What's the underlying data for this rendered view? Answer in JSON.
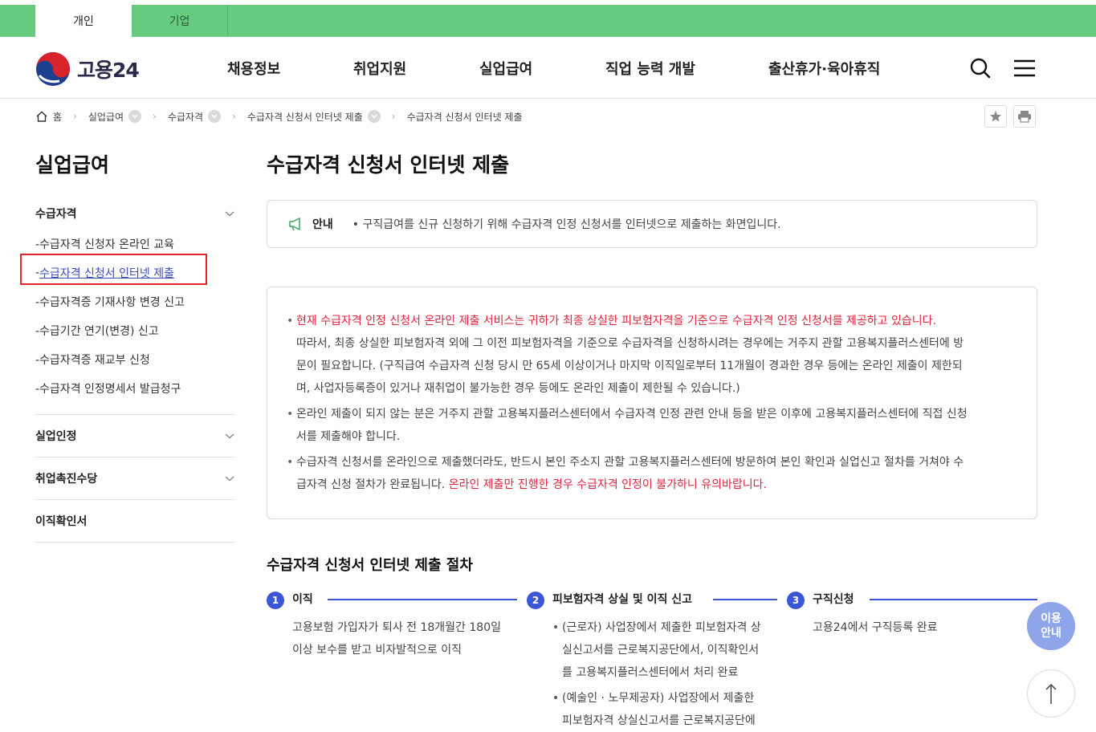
{
  "top_tabs": {
    "personal": "개인",
    "corporate": "기업"
  },
  "header": {
    "logo_text": "고용24",
    "nav": [
      "채용정보",
      "취업지원",
      "실업급여",
      "직업 능력 개발",
      "출산휴가·육아휴직"
    ]
  },
  "breadcrumb": {
    "home": "홈",
    "items": [
      "실업급여",
      "수급자격",
      "수급자격 신청서 인터넷 제출",
      "수급자격 신청서 인터넷 제출"
    ]
  },
  "sidebar": {
    "title": "실업급여",
    "groups": [
      {
        "label": "수급자격",
        "items": [
          "-수급자격 신청자 온라인 교육",
          "수급자격 신청서 인터넷 제출",
          "-수급자격증 기재사항 변경 신고",
          "-수급기간 연기(변경) 신고",
          "-수급자격증 재교부 신청",
          "-수급자격 인정명세서 발급청구"
        ]
      },
      {
        "label": "실업인정"
      },
      {
        "label": "취업촉진수당"
      },
      {
        "label": "이직확인서"
      }
    ]
  },
  "main": {
    "title": "수급자격 신청서 인터넷 제출",
    "notice": {
      "label": "안내",
      "text": "• 구직급여를 신규 신청하기 위해 수급자격 인정 신청서를 인터넷으로 제출하는 화면입니다."
    },
    "info": {
      "b1_red": "현재 수급자격 인정 신청서 온라인 제출 서비스는 귀하가 최종 상실한 피보험자격을 기준으로 수급자격 인정 신청서를 제공하고 있습니다.",
      "b1_l1": "따라서, 최종 상실한 피보험자격 외에 그 이전 피보험자격을 기준으로 수급자격을 신청하시려는 경우에는 거주지 관할 고용복지플러스센터에 방",
      "b1_l2": "문이 필요합니다. (구직급여 수급자격 신청 당시 만 65세 이상이거나 마지막 이직일로부터 11개월이 경과한 경우 등에는 온라인 제출이 제한되",
      "b1_l3": "며, 사업자등록증이 있거나 재취업이 불가능한 경우 등에도 온라인 제출이 제한될 수 있습니다.)",
      "b2_l1": "온라인 제출이 되지 않는 분은 거주지 관할 고용복지플러스센터에서 수급자격 인정 관련 안내 등을 받은 이후에 고용복지플러스센터에 직접 신청",
      "b2_l2": "서를 제출해야 합니다.",
      "b3_l1": "수급자격 신청서를 온라인으로 제출했더라도, 반드시 본인 주소지 관할 고용복지플러스센터에 방문하여 본인 확인과 실업신고 절차를 거쳐야 수",
      "b3_l2": "급자격 신청 절차가 완료됩니다.",
      "b3_red": "온라인 제출만 진행한 경우 수급자격 인정이 불가하니 유의바랍니다."
    },
    "procedure": {
      "title": "수급자격 신청서 인터넷 제출 절차",
      "steps": [
        {
          "num": "1",
          "title": "이직",
          "lines": [
            "고용보험 가입자가 퇴사 전 18개월간 180일",
            "이상 보수를 받고 비자발적으로 이직"
          ]
        },
        {
          "num": "2",
          "title": "피보험자격 상실 및 이직 신고",
          "b1": [
            "(근로자) 사업장에서 제출한 피보험자격 상",
            "실신고서를 근로복지공단에서, 이직확인서",
            "를 고용복지플러스센터에서 처리 완료"
          ],
          "b2": [
            "(예술인 · 노무제공자) 사업장에서 제출한",
            "피보험자격 상실신고서를 근로복지공단에"
          ]
        },
        {
          "num": "3",
          "title": "구직신청",
          "lines": [
            "고용24에서 구직등록 완료"
          ]
        }
      ]
    }
  },
  "floating": {
    "guide_l1": "이용",
    "guide_l2": "안내"
  },
  "colors": {
    "top_bar": "#66cc80",
    "accent_blue": "#3b57d6",
    "alert_red": "#e0253c",
    "guide_button": "#8fa5ea"
  }
}
